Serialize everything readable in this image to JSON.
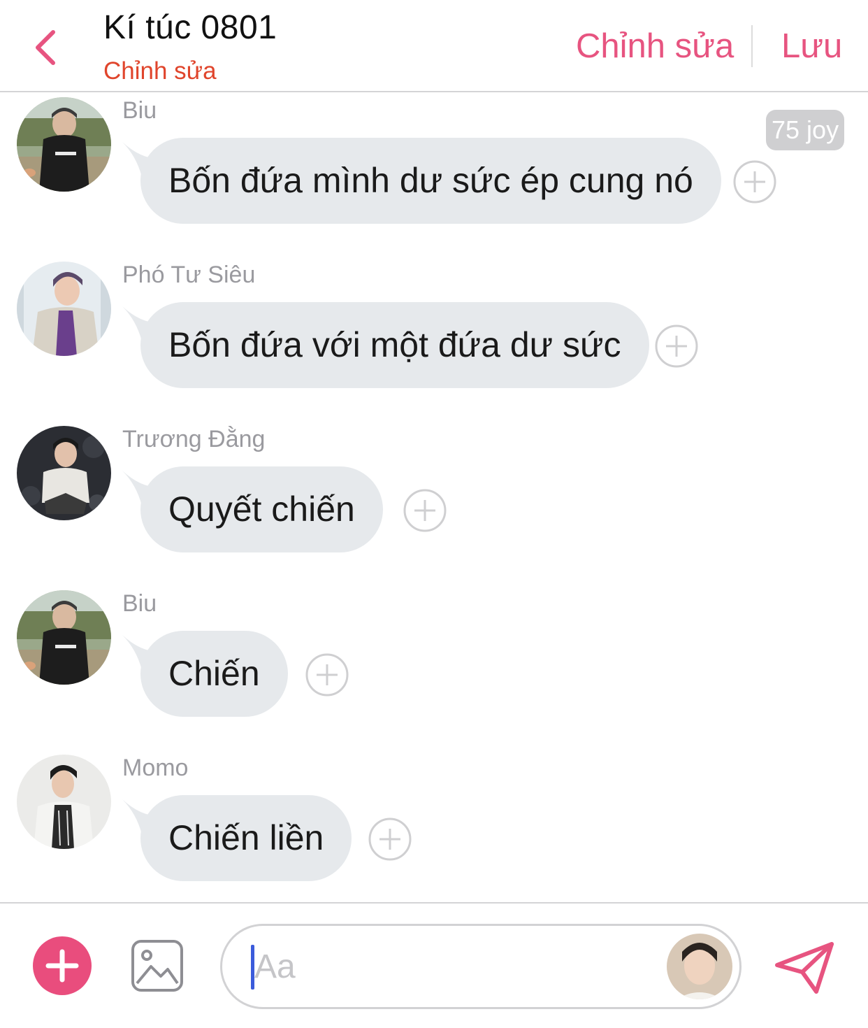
{
  "header": {
    "title": "Kí túc 0801",
    "subtitle": "Chỉnh sửa",
    "edit_label": "Chỉnh sửa",
    "save_label": "Lưu"
  },
  "messages": [
    {
      "sender": "Biu",
      "text": "Bốn đứa mình dư sức ép cung nó",
      "badge": "75 joy"
    },
    {
      "sender": "Phó Tư Siêu",
      "text": "Bốn đứa với một đứa dư sức"
    },
    {
      "sender": "Trương Đằng",
      "text": "Quyết chiến"
    },
    {
      "sender": "Biu",
      "text": "Chiến"
    },
    {
      "sender": "Momo",
      "text": "Chiến liền"
    }
  ],
  "composer": {
    "placeholder": "Aa"
  },
  "colors": {
    "accent": "#e75480",
    "subtitle": "#e0452c",
    "bubble": "#e6e9ec",
    "caret": "#3b5bdb"
  },
  "icons": [
    "back-chevron-icon",
    "add-reaction-icon",
    "plus-icon",
    "image-icon",
    "send-icon"
  ]
}
